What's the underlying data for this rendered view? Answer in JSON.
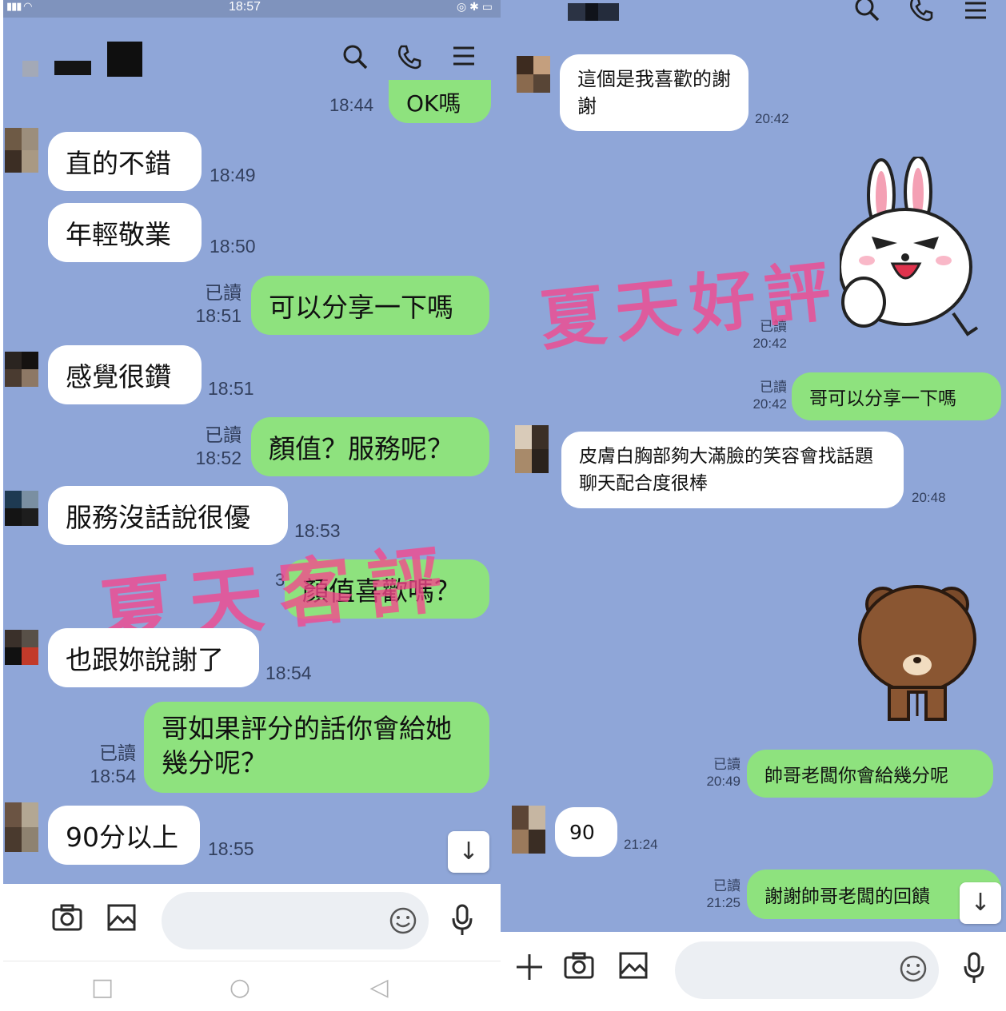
{
  "left": {
    "status": {
      "time": "18:57"
    },
    "partial_top": {
      "text": "OK嗎",
      "time": "18:44"
    },
    "messages": [
      {
        "dir": "in",
        "text": "直的不錯",
        "time": "18:49"
      },
      {
        "dir": "in",
        "text": "年輕敬業",
        "time": "18:50"
      },
      {
        "dir": "out",
        "text": "可以分享一下嗎",
        "read": "已讀",
        "time": "18:51"
      },
      {
        "dir": "in",
        "text": "感覺很鑽",
        "time": "18:51"
      },
      {
        "dir": "out",
        "text": "顏值？服務呢？",
        "read": "已讀",
        "time": "18:52"
      },
      {
        "dir": "in",
        "text": "服務沒話說很優",
        "time": "18:53"
      },
      {
        "dir": "out",
        "text": "顏值喜歡嗎？",
        "read": "3",
        "time": ""
      },
      {
        "dir": "in",
        "text": "也跟妳說謝了",
        "time": "18:54"
      },
      {
        "dir": "out",
        "text": "哥如果評分的話你會給她幾分呢？",
        "read": "已讀",
        "time": "18:54"
      },
      {
        "dir": "in",
        "text": "90分以上",
        "time": "18:55"
      }
    ],
    "watermark": "夏天客評",
    "input": {
      "placeholder": ""
    }
  },
  "right": {
    "messages": [
      {
        "dir": "in",
        "text": "這個是我喜歡的謝謝",
        "time": "20:42"
      },
      {
        "dir": "out-sticker",
        "sticker": "cony-thumbs-up-sticker",
        "read": "已讀",
        "time": "20:42"
      },
      {
        "dir": "out",
        "text": "哥可以分享一下嗎",
        "read": "已讀",
        "time": "20:42"
      },
      {
        "dir": "in",
        "text": "皮膚白胸部夠大滿臉的笑容會找話題聊天配合度很棒",
        "time": "20:48"
      },
      {
        "dir": "in-sticker",
        "sticker": "brown-bear-bow-sticker",
        "time": ""
      },
      {
        "dir": "out",
        "text": "帥哥老闆你會給幾分呢",
        "read": "已讀",
        "time": "20:49"
      },
      {
        "dir": "in",
        "text": "90",
        "time": "21:24"
      },
      {
        "dir": "out",
        "text": "謝謝帥哥老闆的回饋",
        "read": "已讀",
        "time": "21:25"
      }
    ],
    "watermark": "夏天好評",
    "input": {
      "placeholder": ""
    }
  },
  "colors": {
    "chat_bg": "#8fa6d8",
    "incoming_bubble": "#ffffff",
    "outgoing_bubble": "#8ee27e",
    "watermark": "#f5468c"
  },
  "icons": [
    "search-icon",
    "phone-icon",
    "menu-icon",
    "camera-icon",
    "image-icon",
    "emoji-icon",
    "mic-icon",
    "plus-icon",
    "scroll-down-icon"
  ]
}
